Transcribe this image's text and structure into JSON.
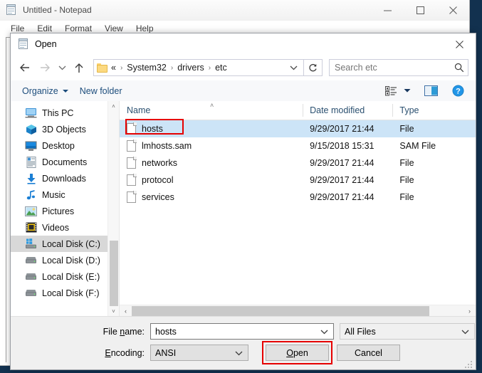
{
  "notepad": {
    "title": "Untitled - Notepad",
    "icon": "notepad-icon",
    "menus": [
      "File",
      "Edit",
      "Format",
      "View",
      "Help"
    ],
    "window_buttons": [
      "minimize",
      "maximize",
      "close"
    ]
  },
  "dialog": {
    "title": "Open",
    "icon": "notepad-icon",
    "close_label": "Close",
    "nav": {
      "back": "back-arrow",
      "forward": "forward-arrow",
      "recent": "recent-locations-chevron",
      "up": "up-arrow",
      "refresh": "refresh-icon"
    },
    "address": {
      "folder_icon": "folder-icon",
      "crumbs": [
        "«",
        "System32",
        "drivers",
        "etc"
      ],
      "separator": "›",
      "dropdown": "chevron-down-icon"
    },
    "search": {
      "placeholder": "Search etc",
      "value": "",
      "icon": "search-icon"
    },
    "toolbar": {
      "organize": "Organize",
      "new_folder": "New folder",
      "view_icon": "view-options-icon",
      "view_caret": "chevron-down-icon",
      "preview_icon": "preview-pane-icon",
      "help_icon": "help-icon",
      "help_glyph": "?"
    },
    "sidebar": {
      "items": [
        {
          "label": "This PC",
          "icon": "this-pc-icon",
          "selected": false
        },
        {
          "label": "3D Objects",
          "icon": "3d-objects-icon",
          "selected": false
        },
        {
          "label": "Desktop",
          "icon": "desktop-icon",
          "selected": false
        },
        {
          "label": "Documents",
          "icon": "documents-icon",
          "selected": false
        },
        {
          "label": "Downloads",
          "icon": "downloads-icon",
          "selected": false
        },
        {
          "label": "Music",
          "icon": "music-icon",
          "selected": false
        },
        {
          "label": "Pictures",
          "icon": "pictures-icon",
          "selected": false
        },
        {
          "label": "Videos",
          "icon": "videos-icon",
          "selected": false
        },
        {
          "label": "Local Disk (C:)",
          "icon": "local-disk-windows-icon",
          "selected": true
        },
        {
          "label": "Local Disk (D:)",
          "icon": "local-disk-icon",
          "selected": false
        },
        {
          "label": "Local Disk (E:)",
          "icon": "local-disk-icon",
          "selected": false
        },
        {
          "label": "Local Disk (F:)",
          "icon": "local-disk-icon",
          "selected": false
        }
      ],
      "scroll_up": "˄",
      "scroll_down": "˅"
    },
    "filelist": {
      "columns": [
        "Name",
        "Date modified",
        "Type"
      ],
      "sort_caret": "˄",
      "rows": [
        {
          "name": "hosts",
          "date": "9/29/2017 21:44",
          "type": "File",
          "selected": true,
          "highlighted": true
        },
        {
          "name": "lmhosts.sam",
          "date": "9/15/2018 15:31",
          "type": "SAM File",
          "selected": false,
          "highlighted": false
        },
        {
          "name": "networks",
          "date": "9/29/2017 21:44",
          "type": "File",
          "selected": false,
          "highlighted": false
        },
        {
          "name": "protocol",
          "date": "9/29/2017 21:44",
          "type": "File",
          "selected": false,
          "highlighted": false
        },
        {
          "name": "services",
          "date": "9/29/2017 21:44",
          "type": "File",
          "selected": false,
          "highlighted": false
        }
      ],
      "hscroll_left": "‹",
      "hscroll_right": "›"
    },
    "footer": {
      "filename_label_pre": "File ",
      "filename_label_key": "n",
      "filename_label_post": "ame:",
      "filename_value": "hosts",
      "filter_value": "All Files",
      "encoding_label_key": "E",
      "encoding_label_post": "ncoding:",
      "encoding_value": "ANSI",
      "open_label_pre": "",
      "open_label_key": "O",
      "open_label_post": "pen",
      "cancel_label": "Cancel",
      "resize_grip": "resize-grip-icon"
    }
  },
  "annotations": {
    "highlight_color": "#e60000",
    "boxes": [
      "hosts-file-entry",
      "open-button"
    ]
  },
  "colors": {
    "selection_blue": "#cce4f7",
    "sidebar_selection": "#d8d8d8",
    "accent_link": "#1d4d7c",
    "desktop": "#12314f"
  }
}
